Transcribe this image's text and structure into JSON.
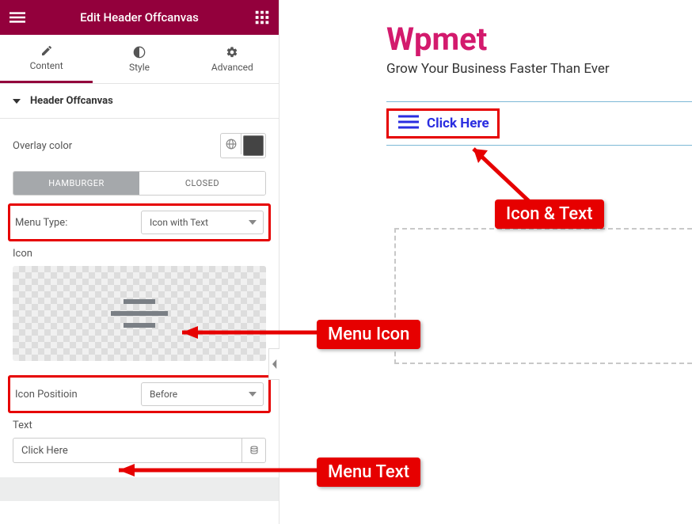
{
  "topbar": {
    "title": "Edit Header Offcanvas"
  },
  "tabs": {
    "content": "Content",
    "style": "Style",
    "advanced": "Advanced"
  },
  "section": {
    "title": "Header Offcanvas"
  },
  "overlay": {
    "label": "Overlay color"
  },
  "segmented": {
    "hamburger": "HAMBURGER",
    "closed": "CLOSED"
  },
  "menu_type": {
    "label": "Menu Type:",
    "value": "Icon with Text"
  },
  "icon": {
    "label": "Icon"
  },
  "icon_position": {
    "label": "Icon Positioin",
    "value": "Before"
  },
  "text": {
    "label": "Text",
    "value": "Click Here"
  },
  "preview": {
    "brand": "Wpmet",
    "tagline": "Grow Your Business Faster Than Ever",
    "button_text": "Click Here"
  },
  "annotations": {
    "icon_text": "Icon & Text",
    "menu_icon": "Menu Icon",
    "menu_text": "Menu Text"
  }
}
